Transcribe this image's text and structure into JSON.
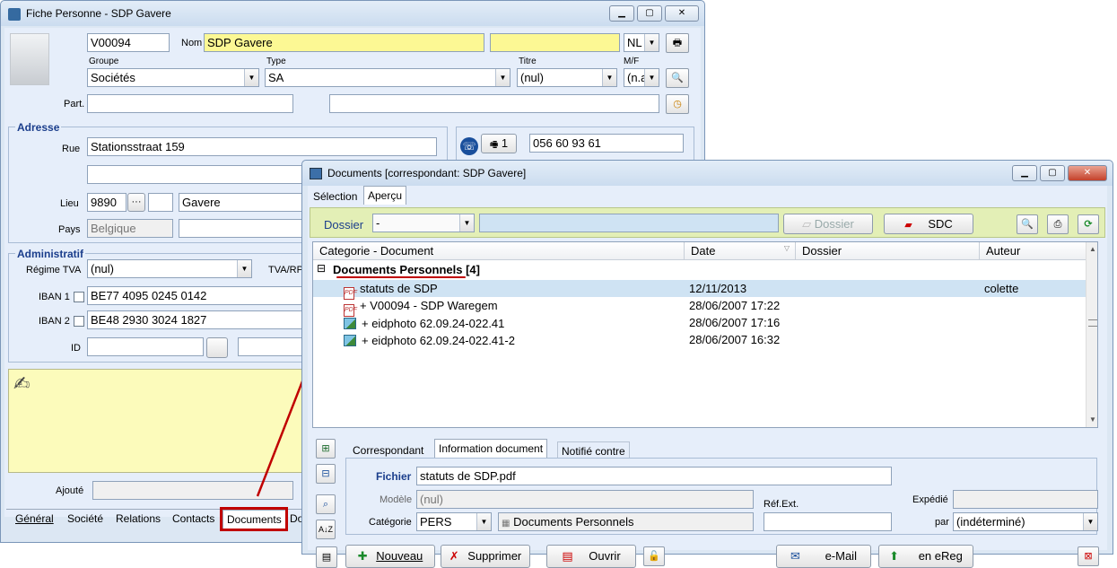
{
  "fiche": {
    "title": "Fiche Personne - SDP Gavere",
    "code": "V00094",
    "nom_label": "Nom",
    "nom": "SDP Gavere",
    "lang": "NL",
    "groupe_label": "Groupe",
    "groupe": "Sociétés",
    "type_label": "Type",
    "type": "SA",
    "titre_label": "Titre",
    "titre": "(nul)",
    "mf_label": "M/F",
    "mf": "(n.a",
    "part_label": "Part.",
    "adresse_label": "Adresse",
    "rue_label": "Rue",
    "rue": "Stationsstraat 159",
    "lieu_label": "Lieu",
    "postcode": "9890",
    "ellipsis": "···",
    "city": "Gavere",
    "pays_label": "Pays",
    "pays": "Belgique",
    "phone_count": "1",
    "phone": "056 60 93 61",
    "admin_label": "Administratif",
    "regime_label": "Régime TVA",
    "regime": "(nul)",
    "tva_label": "TVA/RP",
    "iban1_label": "IBAN 1",
    "iban1": "BE77 4095 0245 0142",
    "iban2_label": "IBAN 2",
    "iban2": "BE48 2930 3024 1827",
    "id_label": "ID",
    "ajoute_label": "Ajouté",
    "tabs": [
      "Général",
      "Société",
      "Relations",
      "Contacts",
      "Documents",
      "Do"
    ]
  },
  "docs": {
    "title": "Documents  [correspondant: SDP Gavere]",
    "tabs": [
      "Sélection",
      "Aperçu"
    ],
    "dossier_label": "Dossier",
    "dossier_value": "-",
    "dossier_btn": "Dossier",
    "sdc_btn": "SDC",
    "columns": [
      "Categorie - Document",
      "Date",
      "Dossier",
      "Auteur"
    ],
    "group_label": "Documents Personnels [4]",
    "collapse": "⊟",
    "rows": [
      {
        "name": "statuts de SDP",
        "date": "12/11/2013",
        "auteur": "colette",
        "icon": "pdf"
      },
      {
        "name": "+ V00094 - SDP Waregem",
        "date": "28/06/2007 17:22",
        "auteur": "",
        "icon": "pdf"
      },
      {
        "name": "+ eidphoto 62.09.24-022.41",
        "date": "28/06/2007 17:16",
        "auteur": "",
        "icon": "image"
      },
      {
        "name": "+ eidphoto 62.09.24-022.41-2",
        "date": "28/06/2007 16:32",
        "auteur": "",
        "icon": "image"
      }
    ],
    "detail_tabs": [
      "Correspondant",
      "Information document",
      "Notifié contre"
    ],
    "fichier_label": "Fichier",
    "fichier": "statuts de SDP.pdf",
    "modele_label": "Modèle",
    "modele": "(nul)",
    "ref_label": "Réf.Ext.",
    "expedie_label": "Expédié",
    "categorie_label": "Catégorie",
    "categorie": "PERS",
    "categorie_desc": "Documents Personnels",
    "par_label": "par",
    "par": "(indéterminé)",
    "buttons": {
      "nouveau": "Nouveau",
      "supprimer": "Supprimer",
      "ouvrir": "Ouvrir",
      "email": "e-Mail",
      "ereg": "en eReg"
    }
  },
  "colors": {
    "highlight_red": "#c00000",
    "selected_row": "#cfe3f3",
    "yellow_field": "#fcf894",
    "toolbar_green": "#e3efb6"
  }
}
